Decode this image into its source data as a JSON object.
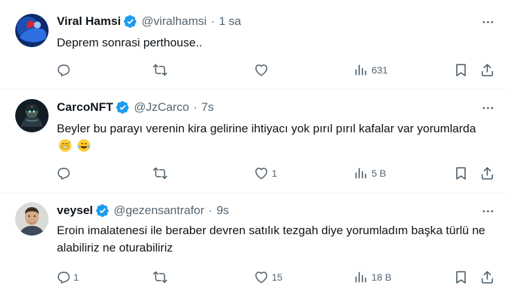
{
  "colors": {
    "accent": "#1d9bf0",
    "muted": "#536471",
    "text": "#0f1419",
    "divider": "#eff3f4"
  },
  "tweets": [
    {
      "name": "Viral Hamsi",
      "handle": "@viralhamsi",
      "separator": "·",
      "time": "1 sa",
      "text": "Deprem sonrasi perthouse..",
      "emojis": [],
      "replies": "",
      "retweets": "",
      "likes": "",
      "views": "631"
    },
    {
      "name": "CarcoNFT",
      "handle": "@JzCarco",
      "separator": "·",
      "time": "7s",
      "text": "Beyler bu parayı verenin kira gelirine ihtiyacı yok pırıl pırıl kafalar var yorumlarda",
      "emojis": [
        "grinning-sweat-emoji",
        "tears-of-joy-emoji"
      ],
      "replies": "",
      "retweets": "",
      "likes": "1",
      "views": "5 B"
    },
    {
      "name": "veysel",
      "handle": "@gezensantrafor",
      "separator": "·",
      "time": "9s",
      "text": "Eroin imalatenesi ile beraber devren satılık tezgah diye yorumladım başka türlü ne alabiliriz ne oturabiliriz",
      "emojis": [],
      "replies": "1",
      "retweets": "",
      "likes": "15",
      "views": "18 B"
    }
  ]
}
